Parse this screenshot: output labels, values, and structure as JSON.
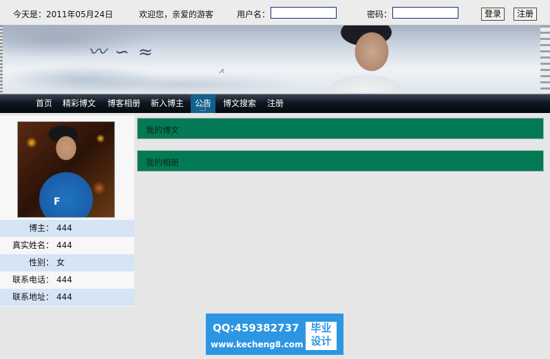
{
  "topbar": {
    "date": "今天是：2011年05月24日",
    "welcome": "欢迎您，亲爱的游客",
    "username_label": "用户名：",
    "username_value": "",
    "password_label": "密码：",
    "password_value": "",
    "login_button": "登录",
    "register_button": "注册"
  },
  "nav": {
    "items": [
      {
        "label": "首页"
      },
      {
        "label": "精彩博文"
      },
      {
        "label": "博客相册"
      },
      {
        "label": "新入博主"
      },
      {
        "label": "公告"
      },
      {
        "label": "博文搜索"
      },
      {
        "label": "注册"
      }
    ],
    "active": "公告"
  },
  "profile": {
    "rows": [
      {
        "label": "博主：",
        "value": "444"
      },
      {
        "label": "真实姓名：",
        "value": "444"
      },
      {
        "label": "性别：",
        "value": "女"
      },
      {
        "label": "联系电话：",
        "value": "444"
      },
      {
        "label": "联系地址：",
        "value": "444"
      }
    ]
  },
  "panels": [
    {
      "title": "我的博文"
    },
    {
      "title": "我的相册"
    }
  ],
  "watermark": {
    "qq": "QQ:459382737",
    "url": "www.kecheng8.com",
    "badge_line1": "毕业",
    "badge_line2": "设计"
  },
  "colors": {
    "nav_active": "#13608d",
    "panel_green": "#037a55",
    "profile_alt_row": "#d6e5f5",
    "watermark_blue": "#2d96e2"
  },
  "icons": {
    "cursor": "hand-pointer-icon"
  }
}
